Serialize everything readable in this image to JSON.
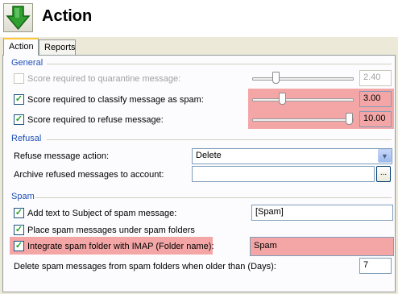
{
  "header": {
    "title": "Action"
  },
  "tabs": [
    {
      "label": "Action",
      "active": true
    },
    {
      "label": "Reports",
      "active": false
    }
  ],
  "general": {
    "label": "General",
    "quarantine": {
      "label": "Score required to quarantine message:",
      "checked": false,
      "enabled": false,
      "value": "2.40",
      "slider_level": 0.1
    },
    "classify": {
      "label": "Score required to classify message as spam:",
      "checked": true,
      "enabled": true,
      "value": "3.00",
      "slider_level": 0.3
    },
    "refuse": {
      "label": "Score required to refuse message:",
      "checked": true,
      "enabled": true,
      "value": "10.00",
      "slider_level": 1.0
    }
  },
  "refusal": {
    "label": "Refusal",
    "action_label": "Refuse message action:",
    "action_value": "Delete",
    "archive_label": "Archive refused messages to account:",
    "archive_value": "",
    "browse_label": "..."
  },
  "spam": {
    "label": "Spam",
    "add_subject": {
      "label": "Add text to Subject of spam message:",
      "checked": true,
      "value": "[Spam]"
    },
    "place_folders": {
      "label": "Place spam messages under spam folders",
      "checked": true
    },
    "imap": {
      "label": "Integrate spam folder with IMAP (Folder name):",
      "checked": true,
      "value": "Spam"
    },
    "delete_days": {
      "label": "Delete spam messages from spam folders when older than (Days):",
      "value": "7"
    }
  },
  "colors": {
    "highlight": "#f4a6a6",
    "group_label": "#1f4fb4",
    "check": "#21a121"
  },
  "icons": {
    "app": "green-down-arrow-icon"
  }
}
